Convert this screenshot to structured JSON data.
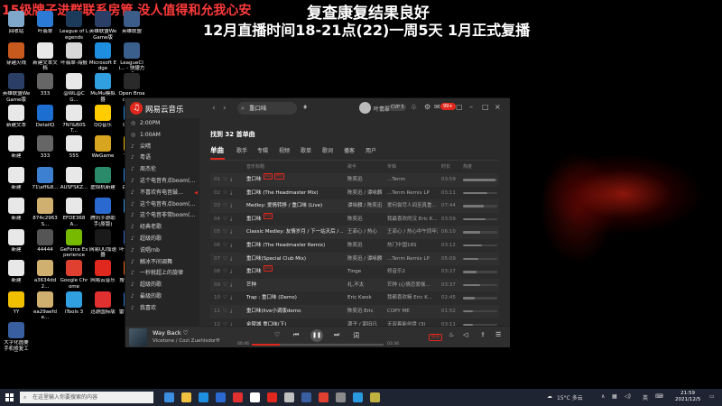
{
  "overlay": {
    "red_text": "15级牌子进群联系房管 没人值得和允我心安",
    "line1": "复查康复结果良好",
    "line2": "12月直播时间18-21点(22)一周5天 1月正式复播"
  },
  "desktop": {
    "icons": [
      {
        "label": "回收站",
        "color": "#7fa7c9"
      },
      {
        "label": "叶翡翠",
        "color": "#2a7ad6"
      },
      {
        "label": "League of Legends",
        "color": "#1c3b5a"
      },
      {
        "label": "英雄联盟WeGame版",
        "color": "#2b3f66"
      },
      {
        "label": "英雄联盟",
        "color": "#3c5d8a"
      },
      {
        "label": "穿越火线",
        "color": "#c85a1e"
      },
      {
        "label": "新建文本文档",
        "color": "#e8e8e8"
      },
      {
        "label": "叶翡翠-海报",
        "color": "#d8d8d8"
      },
      {
        "label": "Microsoft Edge",
        "color": "#1e8fe0"
      },
      {
        "label": "LeagueCli... - 快捷方式",
        "color": "#3b5f8c"
      },
      {
        "label": "英雄联盟WeGame版",
        "color": "#2b3f66"
      },
      {
        "label": "333",
        "color": "#666"
      },
      {
        "label": "@WL@CG...",
        "color": "#e8e8e8"
      },
      {
        "label": "MuMu模拟器",
        "color": "#30a0e0"
      },
      {
        "label": "Open Broadcast...",
        "color": "#2a2a2a"
      },
      {
        "label": "新建文本",
        "color": "#e8e8e8"
      },
      {
        "label": "DetailQ",
        "color": "#1c6fd0"
      },
      {
        "label": "7N?&B0ST...",
        "color": "#e8e8e8"
      },
      {
        "label": "QQ音乐",
        "color": "#ffcc00"
      },
      {
        "label": "QQ游戏",
        "color": "#1f8fe8"
      },
      {
        "label": "新建",
        "color": "#e8e8e8"
      },
      {
        "label": "333",
        "color": "#666"
      },
      {
        "label": "555",
        "color": "#e8e8e8"
      },
      {
        "label": "WeGame",
        "color": "#d8a520"
      },
      {
        "label": "YY语音",
        "color": "#f0c000"
      },
      {
        "label": "新建",
        "color": "#e8e8e8"
      },
      {
        "label": "71\\aff&8...",
        "color": "#3d7fd0"
      },
      {
        "label": "AUSFSKZ...",
        "color": "#e8e8e8"
      },
      {
        "label": "虚拟机新建",
        "color": "#2a8a6a"
      },
      {
        "label": "百度网盘",
        "color": "#2a8ff0"
      },
      {
        "label": "新建",
        "color": "#e8e8e8"
      },
      {
        "label": "874c2963S...",
        "color": "#d0b070"
      },
      {
        "label": "EFDE368A...",
        "color": "#e8e8e8"
      },
      {
        "label": "腾讯手游助手(原版)",
        "color": "#2a6ad0"
      },
      {
        "label": "钉钉",
        "color": "#3a9ae8"
      },
      {
        "label": "新建",
        "color": "#e8e8e8"
      },
      {
        "label": "44444",
        "color": "#555"
      },
      {
        "label": "GeForce Experience",
        "color": "#76b900"
      },
      {
        "label": "网易UU加速器",
        "color": "#1a1a1a"
      },
      {
        "label": "叶翡翠 - 快捷方式",
        "color": "#3a6fd0"
      },
      {
        "label": "新建",
        "color": "#e8e8e8"
      },
      {
        "label": "a3634dd2...",
        "color": "#d0b070"
      },
      {
        "label": "Google Chrome",
        "color": "#e04030"
      },
      {
        "label": "网易云音乐",
        "color": "#e0281e"
      },
      {
        "label": "搜狗加加加",
        "color": "#f07020"
      },
      {
        "label": "YY",
        "color": "#f0c000"
      },
      {
        "label": "ea29aefde...",
        "color": "#d0b070"
      },
      {
        "label": "iTools 3",
        "color": "#30a0e0"
      },
      {
        "label": "迅游国际版",
        "color": "#e03030"
      },
      {
        "label": "雷宇LAM机模拟器",
        "color": "#2a7ad0"
      },
      {
        "label": "大字化图要手机修复工具",
        "color": "#3a5fa0"
      }
    ]
  },
  "app": {
    "name": "网易云音乐",
    "search_value": "重口味",
    "user_name": "叶翡翠",
    "vip": "CVP 5",
    "notif_count": "99+",
    "sidebar": [
      {
        "icon": "◎",
        "label": "2:00PM"
      },
      {
        "icon": "◎",
        "label": "1:00AM"
      },
      {
        "icon": "♪",
        "label": "尖晴"
      },
      {
        "icon": "♪",
        "label": "粤语"
      },
      {
        "icon": "♪",
        "label": "周杰伦"
      },
      {
        "icon": "♪",
        "label": "这个电音有点boom(…"
      },
      {
        "icon": "♪",
        "label": "不喜欢有电音鼓…",
        "side": "◀"
      },
      {
        "icon": "♪",
        "label": "这个电音有点boom(…"
      },
      {
        "icon": "♪",
        "label": "这个电音非常boom(…"
      },
      {
        "icon": "♪",
        "label": "经典老歌"
      },
      {
        "icon": "♪",
        "label": "超级的歌"
      },
      {
        "icon": "♪",
        "label": "说唱rnb"
      },
      {
        "icon": "♪",
        "label": "触冰不间调舞"
      },
      {
        "icon": "♪",
        "label": "一秒就超上的旋律"
      },
      {
        "icon": "♪",
        "label": "超级的歌"
      },
      {
        "icon": "♪",
        "label": "最级的歌"
      },
      {
        "icon": "♪",
        "label": "我喜欢"
      }
    ],
    "found_text": "找到 32 首单曲",
    "tabs": [
      "单曲",
      "歌手",
      "专辑",
      "视频",
      "歌单",
      "歌词",
      "播客",
      "用户"
    ],
    "table_header": {
      "title": "音乐标题",
      "artist": "歌手",
      "album": "专辑",
      "duration": "时长",
      "heat": "热度"
    },
    "rows": [
      {
        "num": "01",
        "title": "重口味",
        "badges": [
          "SQ",
          "MV"
        ],
        "artist": "陈奕迅",
        "album": "...Tenm",
        "duration": "03:59",
        "heat": 0.95
      },
      {
        "num": "02",
        "title": "重口味 (The Headmaster Mix)",
        "badges": [],
        "artist": "陈奕迅 / 谭咏麟",
        "album": "...Tenm Remix LP",
        "duration": "03:11",
        "heat": 0.7
      },
      {
        "num": "03",
        "title": "Medley: 爱情转移 / 重口味 (Live)",
        "badges": [],
        "artist": "谭咏麟 / 陈奕迅",
        "album": "爱何尝尽人间至真重...",
        "duration": "07:44",
        "heat": 0.6
      },
      {
        "num": "04",
        "title": "重口味",
        "badges": [
          "SQ"
        ],
        "artist": "陈奕迅",
        "album": "我最喜欢的汉 Eric K...",
        "duration": "03:59",
        "heat": 0.65
      },
      {
        "num": "05",
        "title": "Classic Medley: 友情岁月 / 下一站天后 / ...",
        "badges": [],
        "artist": "王菲心 / 热心",
        "album": "王菲心 / 热心中午同年演...",
        "duration": "06:10",
        "heat": 0.5
      },
      {
        "num": "06",
        "title": "重口味 (The Headmaster Remix)",
        "badges": [],
        "artist": "陈奕迅",
        "album": "热门中国18S",
        "duration": "03:12",
        "heat": 0.55
      },
      {
        "num": "07",
        "title": "重口味(Special Club Mix)",
        "badges": [],
        "artist": "陈奕迅 / 谭咏麟",
        "album": "...Tenm Remix LP",
        "duration": "05:09",
        "heat": 0.45
      },
      {
        "num": "08",
        "title": "重口味",
        "badges": [
          "SQ"
        ],
        "artist": "Tinge",
        "album": "修音乐2",
        "duration": "03:27",
        "heat": 0.4
      },
      {
        "num": "09",
        "title": "芒种",
        "badges": [],
        "artist": "礼,不太",
        "album": "芒种 (心情恋爱咖...",
        "duration": "03:37",
        "heat": 0.5
      },
      {
        "num": "10",
        "title": "Trap : 重口味 (Demo)",
        "badges": [],
        "artist": "Eric Kwok",
        "album": "我都喜欢嘛 Eric K...",
        "duration": "02:45",
        "heat": 0.35
      },
      {
        "num": "11",
        "title": "重口味(live小调版demo",
        "badges": [],
        "artist": "陈奕迅 Eric",
        "album": "COPY ME",
        "duration": "01:52",
        "heat": 0.3
      },
      {
        "num": "12",
        "title": "金陵城 重口味(下)",
        "badges": [],
        "artist": "源子 / 郭旧凡",
        "album": "无双着能创盘 (3)",
        "duration": "03:11",
        "heat": 0.3
      }
    ],
    "player": {
      "title": "Way Back",
      "artist": "Vicetone / Cozi Zuehlsdorff",
      "elapsed": "00:46",
      "total": "03:36",
      "progress": 0.21,
      "quality": "极高"
    }
  },
  "taskbar": {
    "search_placeholder": "在这里输入你要搜索的内容",
    "apps": [
      "#3b8ee0",
      "#f0c040",
      "#1e8fe0",
      "#2a6ad0",
      "#e03030",
      "#ffffff",
      "#e0281e",
      "#c0c0c0",
      "#3a5fa0",
      "#e04030",
      "#8a8a8a",
      "#2a9ae0",
      "#c0b040"
    ],
    "weather": "15°C 多云",
    "ime": "英",
    "time": "21:59",
    "date": "2021/12/5"
  }
}
